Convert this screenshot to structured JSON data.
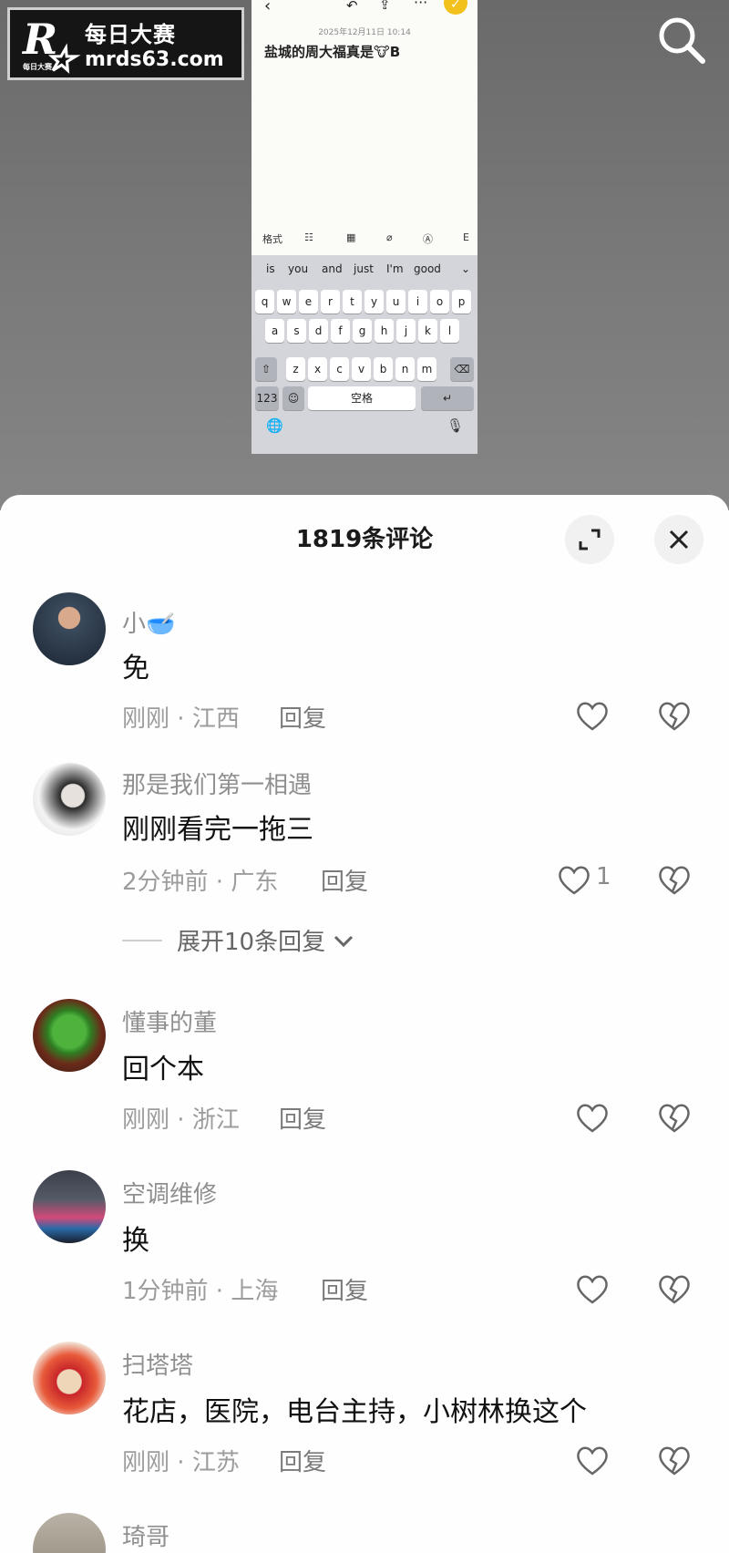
{
  "watermark": {
    "line1": "每日大赛",
    "line2": "mrds63.com",
    "logo_letter": "R",
    "logo_small": "每日大赛"
  },
  "video": {
    "note_date": "2025年12月11日 10:14",
    "note_title": "盐城的周大福真是🐮B",
    "toolbar": [
      "格式",
      "☷",
      "▦",
      "⌀",
      "Ⓐ",
      "E"
    ],
    "suggestions": [
      "is",
      "you",
      "and",
      "just",
      "I'm",
      "good",
      "⌄"
    ],
    "keys_row1": [
      "q",
      "w",
      "e",
      "r",
      "t",
      "y",
      "u",
      "i",
      "o",
      "p"
    ],
    "keys_row2": [
      "a",
      "s",
      "d",
      "f",
      "g",
      "h",
      "j",
      "k",
      "l"
    ],
    "keys_row3": [
      "z",
      "x",
      "c",
      "v",
      "b",
      "n",
      "m"
    ],
    "key_123": "123",
    "key_space": "空格",
    "key_shift": "⇧",
    "key_delete": "⌫",
    "key_return": "↵",
    "key_emoji": "☺",
    "key_globe": "🌐",
    "key_mic": "🎙"
  },
  "sheet": {
    "title": "1819条评论"
  },
  "comments": [
    {
      "user": "小🥣",
      "text": "免",
      "time": "刚刚",
      "region": "江西",
      "reply": "回复",
      "likes": ""
    },
    {
      "user": "那是我们第一相遇",
      "text": "刚刚看完一拖三",
      "time": "2分钟前",
      "region": "广东",
      "reply": "回复",
      "likes": "1",
      "expand": "展开10条回复"
    },
    {
      "user": "懂事的董",
      "text": "回个本",
      "time": "刚刚",
      "region": "浙江",
      "reply": "回复",
      "likes": ""
    },
    {
      "user": "空调维修",
      "text": "换",
      "time": "1分钟前",
      "region": "上海",
      "reply": "回复",
      "likes": ""
    },
    {
      "user": "扫塔塔",
      "text": "花店，医院，电台主持，小树林换这个",
      "time": "刚刚",
      "region": "江苏",
      "reply": "回复",
      "likes": ""
    },
    {
      "user": "琦哥",
      "text": "",
      "time": "",
      "region": "",
      "reply": "",
      "likes": ""
    }
  ],
  "meta_separator": " · ",
  "icons": {
    "search": "search-icon",
    "expand": "expand-icon",
    "close": "close-icon",
    "like": "heart-icon",
    "dislike": "broken-heart-icon",
    "chevron": "chevron-down-icon"
  },
  "colors": {
    "sheet_bg": "#fefefe",
    "meta_gray": "#9c9c9c",
    "check_yellow": "#f3c11c"
  }
}
